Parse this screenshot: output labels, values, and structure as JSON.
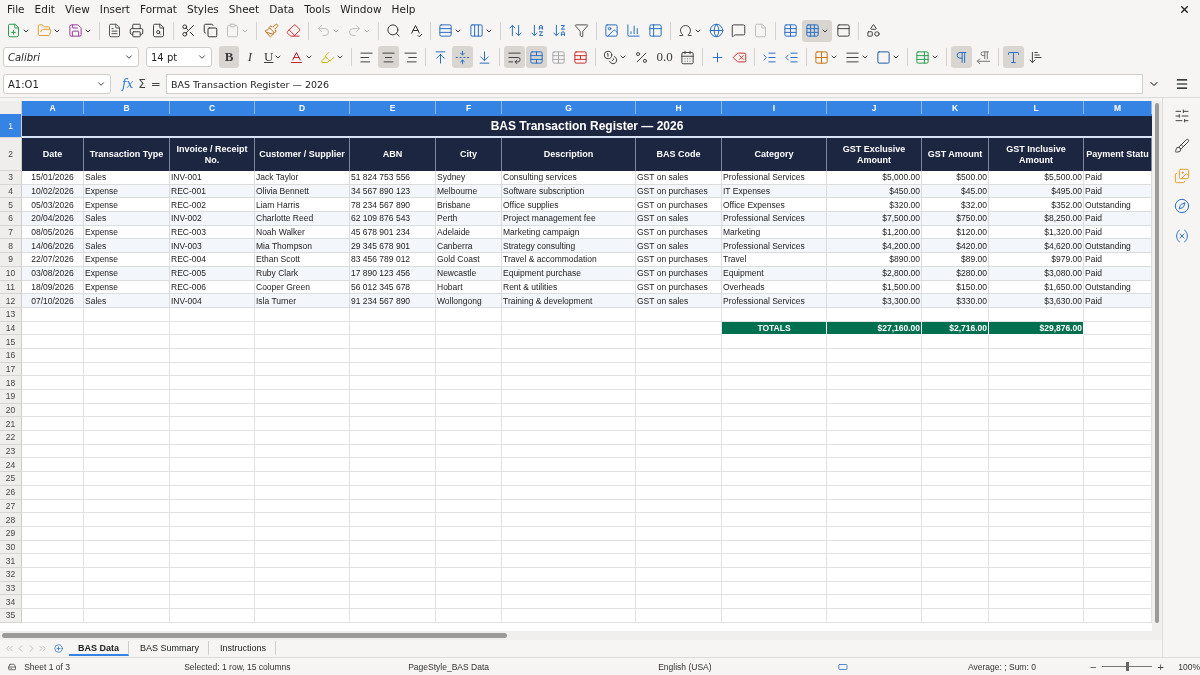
{
  "menu": [
    "File",
    "Edit",
    "View",
    "Insert",
    "Format",
    "Styles",
    "Sheet",
    "Data",
    "Tools",
    "Window",
    "Help"
  ],
  "toolbar": [
    {
      "kind": "new",
      "dropdown": true
    },
    {
      "kind": "open",
      "dropdown": true
    },
    {
      "kind": "save",
      "dropdown": true
    },
    {
      "kind": "separator"
    },
    {
      "kind": "pdf"
    },
    {
      "kind": "print"
    },
    {
      "kind": "preview"
    },
    {
      "kind": "separator"
    },
    {
      "kind": "cut"
    },
    {
      "kind": "copy"
    },
    {
      "kind": "paste",
      "dropdown": true,
      "disabled": true
    },
    {
      "kind": "separator"
    },
    {
      "kind": "clone"
    },
    {
      "kind": "clear"
    },
    {
      "kind": "separator"
    },
    {
      "kind": "undo",
      "dropdown": true,
      "disabled": true
    },
    {
      "kind": "redo",
      "dropdown": true,
      "disabled": true
    },
    {
      "kind": "separator"
    },
    {
      "kind": "find"
    },
    {
      "kind": "spelling"
    },
    {
      "kind": "separator"
    },
    {
      "kind": "row",
      "dropdown": true
    },
    {
      "kind": "column",
      "dropdown": true
    },
    {
      "kind": "separator"
    },
    {
      "kind": "sort"
    },
    {
      "kind": "sort-asc"
    },
    {
      "kind": "sort-desc"
    },
    {
      "kind": "filter"
    },
    {
      "kind": "separator"
    },
    {
      "kind": "image"
    },
    {
      "kind": "chart"
    },
    {
      "kind": "pivot"
    },
    {
      "kind": "separator"
    },
    {
      "kind": "special",
      "dropdown": true
    },
    {
      "kind": "link"
    },
    {
      "kind": "comment"
    },
    {
      "kind": "headerfooter",
      "disabled": true
    },
    {
      "kind": "separator"
    },
    {
      "kind": "printrange"
    },
    {
      "kind": "freeze",
      "dropdown": true,
      "selected": true
    },
    {
      "kind": "split",
      "selected": false
    },
    {
      "kind": "separator"
    },
    {
      "kind": "shapes"
    }
  ],
  "format_bar": {
    "font_name": "Calibri",
    "font_size": "14 pt",
    "items": [
      {
        "kind": "text",
        "label": "B",
        "bold": true,
        "selected": true
      },
      {
        "kind": "text",
        "label": "I",
        "italic": true,
        "selected": false
      },
      {
        "kind": "text",
        "label": "U",
        "underline": true,
        "dropdown": true,
        "selected": false
      },
      {
        "kind": "fontcolor",
        "dropdown": true
      },
      {
        "kind": "highlight",
        "dropdown": true
      },
      {
        "kind": "separator"
      },
      {
        "kind": "align-left",
        "selected": false
      },
      {
        "kind": "align-center",
        "selected": true
      },
      {
        "kind": "align-right",
        "selected": false
      },
      {
        "kind": "separator"
      },
      {
        "kind": "align-top",
        "selected": false
      },
      {
        "kind": "align-middle",
        "selected": true
      },
      {
        "kind": "align-bottom",
        "selected": false
      },
      {
        "kind": "separator"
      },
      {
        "kind": "wrap",
        "selected": true
      },
      {
        "kind": "merge",
        "selected": true
      },
      {
        "kind": "unmerge"
      },
      {
        "kind": "split-cells"
      },
      {
        "kind": "separator"
      },
      {
        "kind": "currency",
        "dropdown": true
      },
      {
        "kind": "percent"
      },
      {
        "kind": "text",
        "label": "0.0"
      },
      {
        "kind": "date"
      },
      {
        "kind": "separator"
      },
      {
        "kind": "add-decimal"
      },
      {
        "kind": "remove-decimal"
      },
      {
        "kind": "separator"
      },
      {
        "kind": "indent"
      },
      {
        "kind": "outdent"
      },
      {
        "kind": "separator"
      },
      {
        "kind": "borders",
        "dropdown": true
      },
      {
        "kind": "borderstyle",
        "dropdown": true
      },
      {
        "kind": "bordercolor",
        "dropdown": true
      },
      {
        "kind": "separator"
      },
      {
        "kind": "conditional",
        "dropdown": true
      },
      {
        "kind": "separator"
      },
      {
        "kind": "ltr",
        "selected": true
      },
      {
        "kind": "rtl",
        "selected": false
      },
      {
        "kind": "separator"
      },
      {
        "kind": "textdir",
        "selected": true
      },
      {
        "kind": "vertical",
        "selected": false
      }
    ]
  },
  "formula_bar": {
    "name_box": "A1:O1",
    "function_label": "fx",
    "sum_label": "Σ",
    "equals_label": "=",
    "content": "BAS Transaction Register — 2026"
  },
  "columns": [
    {
      "letter": "A",
      "selected": true
    },
    {
      "letter": "B",
      "selected": true
    },
    {
      "letter": "C",
      "selected": true
    },
    {
      "letter": "D",
      "selected": true
    },
    {
      "letter": "E",
      "selected": true
    },
    {
      "letter": "F",
      "selected": true
    },
    {
      "letter": "G",
      "selected": true
    },
    {
      "letter": "H",
      "selected": true
    },
    {
      "letter": "I",
      "selected": true
    },
    {
      "letter": "J",
      "selected": true
    },
    {
      "letter": "K",
      "selected": true
    },
    {
      "letter": "L",
      "selected": true
    },
    {
      "letter": "M",
      "selected": true
    }
  ],
  "rows": [
    {
      "number": "1",
      "selected": true,
      "kind": "title",
      "text": "BAS Transaction Register — 2026"
    },
    {
      "number": "2",
      "selected": false,
      "kind": "header",
      "cells": [
        "Date",
        "Transaction Type",
        "Invoice / Receipt No.",
        "Customer / Supplier",
        "ABN",
        "City",
        "Description",
        "BAS Code",
        "Category",
        "GST Exclusive Amount",
        "GST Amount",
        "GST Inclusive Amount",
        "Payment Statu"
      ]
    },
    {
      "number": "3",
      "selected": false,
      "kind": "data",
      "cells": [
        "15/01/2026",
        "Sales",
        "INV-001",
        "Jack Taylor",
        "51 824 753 556",
        "Sydney",
        "Consulting services",
        "GST on sales",
        "Professional Services",
        "$5,000.00",
        "$500.00",
        "$5,500.00",
        "Paid"
      ]
    },
    {
      "number": "4",
      "selected": false,
      "kind": "data",
      "cells": [
        "10/02/2026",
        "Expense",
        "REC-001",
        "Olivia Bennett",
        "34 567 890 123",
        "Melbourne",
        "Software subscription",
        "GST on purchases",
        "IT Expenses",
        "$450.00",
        "$45.00",
        "$495.00",
        "Paid"
      ]
    },
    {
      "number": "5",
      "selected": false,
      "kind": "data",
      "cells": [
        "05/03/2026",
        "Expense",
        "REC-002",
        "Liam Harris",
        "78 234 567 890",
        "Brisbane",
        "Office supplies",
        "GST on purchases",
        "Office Expenses",
        "$320.00",
        "$32.00",
        "$352.00",
        "Outstanding"
      ]
    },
    {
      "number": "6",
      "selected": false,
      "kind": "data",
      "cells": [
        "20/04/2026",
        "Sales",
        "INV-002",
        "Charlotte Reed",
        "62 109 876 543",
        "Perth",
        "Project management fee",
        "GST on sales",
        "Professional Services",
        "$7,500.00",
        "$750.00",
        "$8,250.00",
        "Paid"
      ]
    },
    {
      "number": "7",
      "selected": false,
      "kind": "data",
      "cells": [
        "08/05/2026",
        "Expense",
        "REC-003",
        "Noah Walker",
        "45 678 901 234",
        "Adelaide",
        "Marketing campaign",
        "GST on purchases",
        "Marketing",
        "$1,200.00",
        "$120.00",
        "$1,320.00",
        "Paid"
      ]
    },
    {
      "number": "8",
      "selected": false,
      "kind": "data",
      "cells": [
        "14/06/2026",
        "Sales",
        "INV-003",
        "Mia Thompson",
        "29 345 678 901",
        "Canberra",
        "Strategy consulting",
        "GST on sales",
        "Professional Services",
        "$4,200.00",
        "$420.00",
        "$4,620.00",
        "Outstanding"
      ]
    },
    {
      "number": "9",
      "selected": false,
      "kind": "data",
      "cells": [
        "22/07/2026",
        "Expense",
        "REC-004",
        "Ethan Scott",
        "83 456 789 012",
        "Gold Coast",
        "Travel & accommodation",
        "GST on purchases",
        "Travel",
        "$890.00",
        "$89.00",
        "$979.00",
        "Paid"
      ]
    },
    {
      "number": "10",
      "selected": false,
      "kind": "data",
      "cells": [
        "03/08/2026",
        "Expense",
        "REC-005",
        "Ruby Clark",
        "17 890 123 456",
        "Newcastle",
        "Equipment purchase",
        "GST on purchases",
        "Equipment",
        "$2,800.00",
        "$280.00",
        "$3,080.00",
        "Paid"
      ]
    },
    {
      "number": "11",
      "selected": false,
      "kind": "data",
      "cells": [
        "18/09/2026",
        "Expense",
        "REC-006",
        "Cooper Green",
        "56 012 345 678",
        "Hobart",
        "Rent & utilities",
        "GST on purchases",
        "Overheads",
        "$1,500.00",
        "$150.00",
        "$1,650.00",
        "Outstanding"
      ]
    },
    {
      "number": "12",
      "selected": false,
      "kind": "data",
      "cells": [
        "07/10/2026",
        "Sales",
        "INV-004",
        "Isla Turner",
        "91 234 567 890",
        "Wollongong",
        "Training & development",
        "GST on sales",
        "Professional Services",
        "$3,300.00",
        "$330.00",
        "$3,630.00",
        "Paid"
      ]
    },
    {
      "number": "13",
      "selected": false,
      "kind": "empty"
    },
    {
      "number": "14",
      "selected": false,
      "kind": "totals",
      "label": "TOTALS",
      "cells": [
        "$27,160.00",
        "$2,716.00",
        "$29,876.00"
      ]
    },
    {
      "number": "15",
      "selected": false,
      "kind": "empty"
    },
    {
      "number": "16",
      "selected": false,
      "kind": "empty"
    },
    {
      "number": "17",
      "selected": false,
      "kind": "empty"
    },
    {
      "number": "18",
      "selected": false,
      "kind": "empty"
    },
    {
      "number": "19",
      "selected": false,
      "kind": "empty"
    },
    {
      "number": "20",
      "selected": false,
      "kind": "empty"
    },
    {
      "number": "21",
      "selected": false,
      "kind": "empty"
    },
    {
      "number": "22",
      "selected": false,
      "kind": "empty"
    },
    {
      "number": "23",
      "selected": false,
      "kind": "empty"
    },
    {
      "number": "24",
      "selected": false,
      "kind": "empty"
    },
    {
      "number": "25",
      "selected": false,
      "kind": "empty"
    },
    {
      "number": "26",
      "selected": false,
      "kind": "empty"
    },
    {
      "number": "27",
      "selected": false,
      "kind": "empty"
    },
    {
      "number": "28",
      "selected": false,
      "kind": "empty"
    },
    {
      "number": "29",
      "selected": false,
      "kind": "empty"
    },
    {
      "number": "30",
      "selected": false,
      "kind": "empty"
    },
    {
      "number": "31",
      "selected": false,
      "kind": "empty"
    },
    {
      "number": "32",
      "selected": false,
      "kind": "empty"
    },
    {
      "number": "33",
      "selected": false,
      "kind": "empty"
    },
    {
      "number": "34",
      "selected": false,
      "kind": "empty"
    },
    {
      "number": "35",
      "selected": false,
      "kind": "empty"
    }
  ],
  "sheet_tabs": [
    {
      "label": "BAS Data",
      "selected": true
    },
    {
      "label": "BAS Summary",
      "selected": false
    },
    {
      "label": "Instructions",
      "selected": false
    }
  ],
  "sidebar": [
    {
      "kind": "properties"
    },
    {
      "kind": "styles"
    },
    {
      "kind": "gallery"
    },
    {
      "kind": "navigator"
    },
    {
      "kind": "functions"
    }
  ],
  "status_bar": {
    "sheet": "Sheet 1 of 3",
    "selection": "Selected: 1 row, 15 columns",
    "page_style": "PageStyle_BAS Data",
    "language": "English (USA)",
    "summary": "Average: ; Sum: 0",
    "zoom": {
      "out_label": "−",
      "level": 0.5,
      "in_label": "+",
      "reading": "100%"
    }
  }
}
